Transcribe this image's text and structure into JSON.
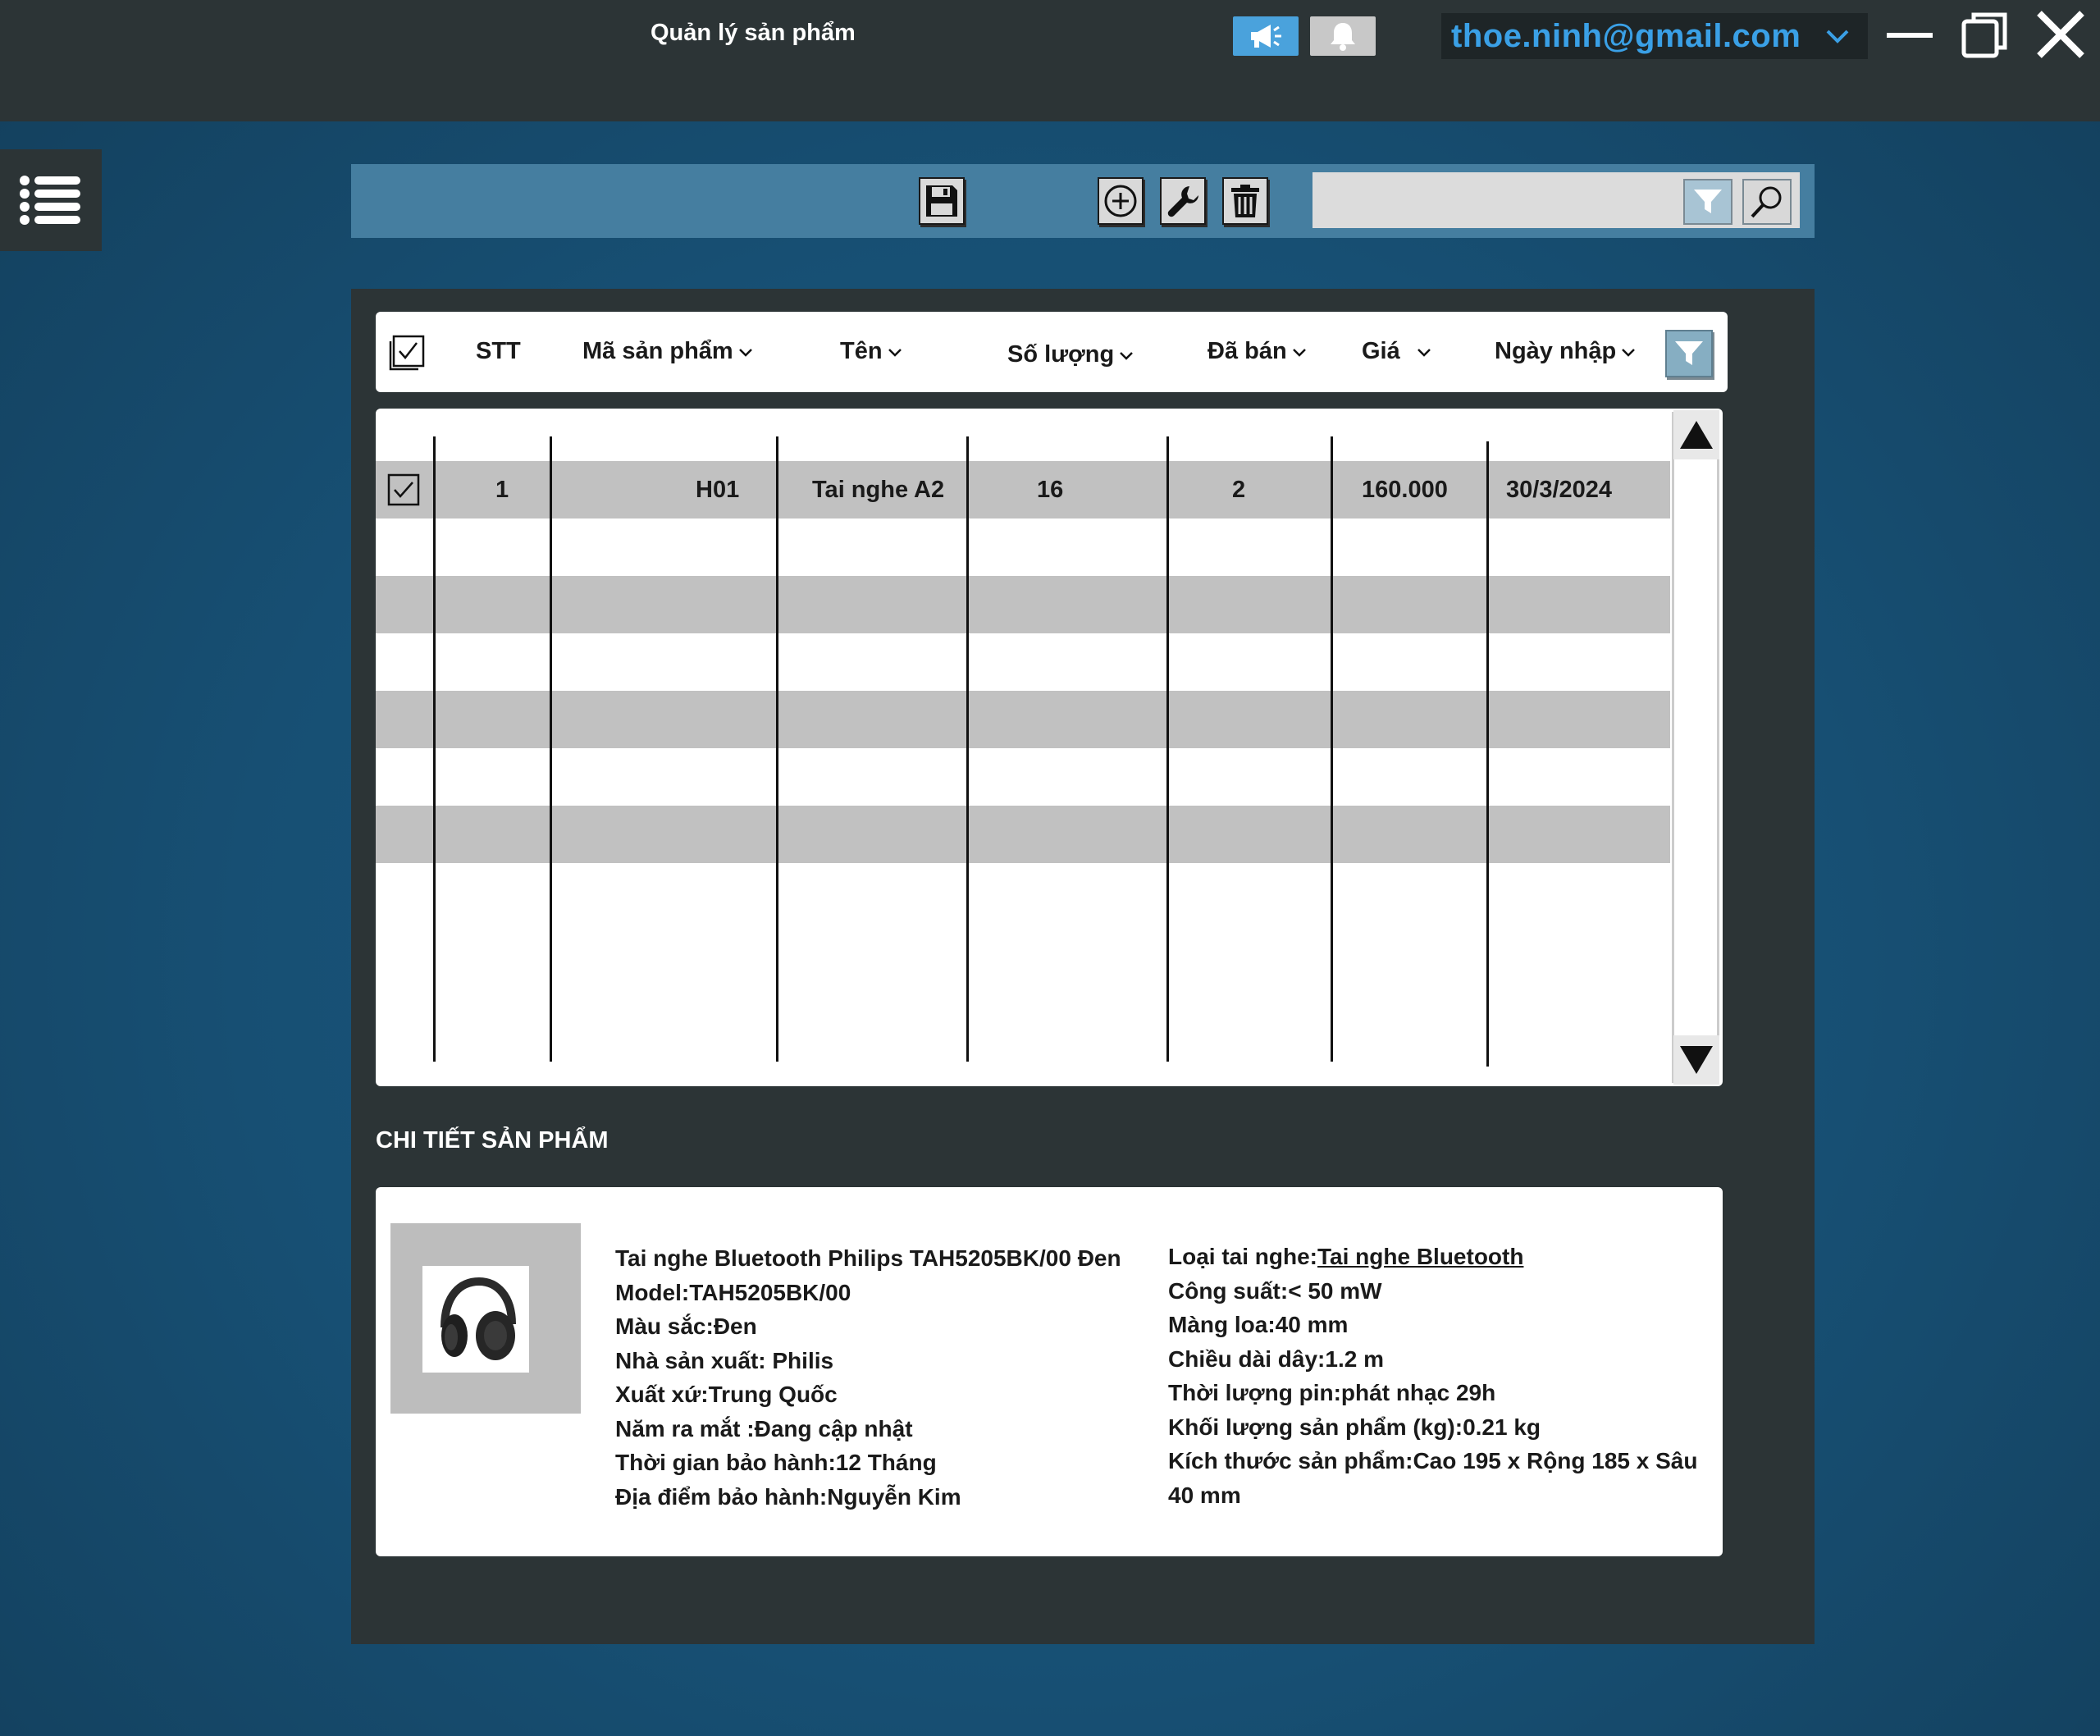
{
  "window": {
    "title": "Quản lý sản phẩm",
    "account_email": "thoe.ninh@gmail.com",
    "icons": {
      "announce": "megaphone-icon",
      "notifications": "bell-icon",
      "account_dropdown": "chevron-down-icon",
      "minimize": "minimize-icon",
      "restore": "restore-icon",
      "close": "close-icon"
    }
  },
  "sidebar": {
    "menu_icon": "list-menu-icon"
  },
  "toolbar": {
    "icons": [
      "save-icon",
      "add-circle-icon",
      "wrench-icon",
      "trash-icon"
    ],
    "search": {
      "value": "",
      "placeholder": ""
    },
    "filter_icon": "filter-icon",
    "search_icon": "magnifier-icon"
  },
  "table": {
    "columns": [
      {
        "key": "stt",
        "label": "STT"
      },
      {
        "key": "ma",
        "label": "Mã sản phẩm"
      },
      {
        "key": "ten",
        "label": "Tên"
      },
      {
        "key": "sl",
        "label": "Số lượng"
      },
      {
        "key": "daban",
        "label": "Đã bán"
      },
      {
        "key": "gia",
        "label": "Giá"
      },
      {
        "key": "ngay",
        "label": "Ngày nhập"
      }
    ],
    "rows": [
      {
        "checked": true,
        "stt": "1",
        "ma": "H01",
        "ten": "Tai nghe A2",
        "sl": "16",
        "daban": "2",
        "gia": "160.000",
        "ngay": "30/3/2024"
      }
    ],
    "total_row_slots": 7
  },
  "detail": {
    "title": "CHI TIẾT SẢN PHẨM",
    "image_icon": "headphones-icon",
    "left": [
      "Tai nghe Bluetooth Philips TAH5205BK/00 Đen",
      "Model:TAH5205BK/00",
      "Màu sắc:Đen",
      "Nhà sản xuất: Philis",
      "Xuất xứ:Trung Quốc",
      "Năm ra mắt :Đang cập nhật",
      "Thời gian bảo hành:12 Tháng",
      "Địa điểm bảo hành:Nguyễn Kim"
    ],
    "right": {
      "type_label": "Loại tai nghe:",
      "type_link": "Tai nghe Bluetooth",
      "lines": [
        "Công suất:< 50 mW",
        "Màng loa:40 mm",
        "Chiều dài dây:1.2 m",
        "Thời lượng pin:phát nhạc 29h",
        "Khối lượng sản phẩm (kg):0.21 kg",
        "Kích thước sản phẩm:Cao 195 x Rộng 185 x Sâu 40 mm"
      ]
    }
  },
  "colors": {
    "background": "#174f73",
    "titlebar": "#2c3436",
    "toolbar": "#457ea0",
    "accent": "#3aa0e6",
    "row_stripe": "#c1c1c1"
  }
}
